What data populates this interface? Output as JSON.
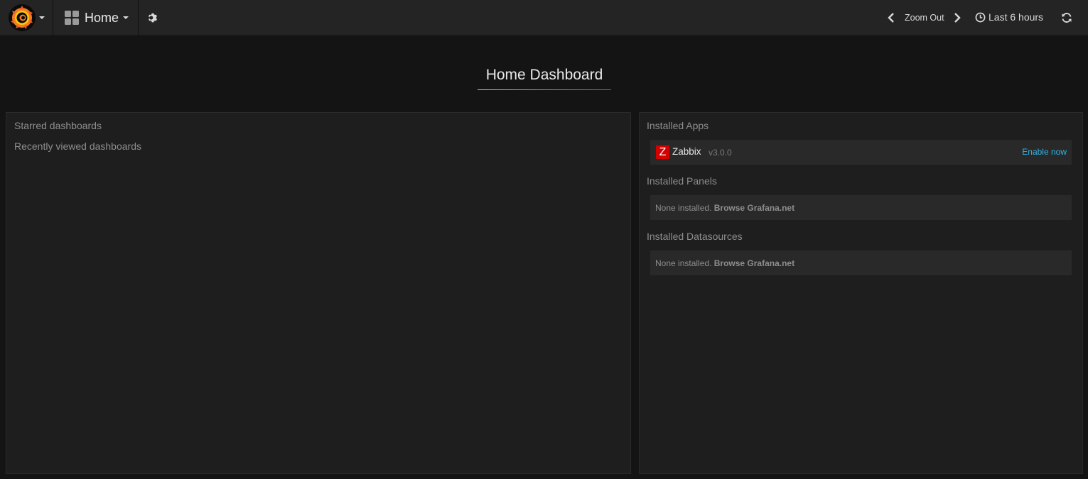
{
  "topbar": {
    "home_label": "Home",
    "zoom_out_label": "Zoom Out",
    "time_range_label": "Last 6 hours"
  },
  "dashboard": {
    "title": "Home Dashboard"
  },
  "left_panel": {
    "starred_heading": "Starred dashboards",
    "recent_heading": "Recently viewed dashboards"
  },
  "right_panel": {
    "apps_heading": "Installed Apps",
    "apps": [
      {
        "logo_letter": "Z",
        "name": "Zabbix",
        "version": "v3.0.0",
        "action_label": "Enable now"
      }
    ],
    "panels_heading": "Installed Panels",
    "panels_none_text": "None installed.",
    "panels_browse_link": "Browse Grafana.net",
    "datasources_heading": "Installed Datasources",
    "datasources_none_text": "None installed.",
    "datasources_browse_link": "Browse Grafana.net"
  },
  "colors": {
    "accent_link": "#33b5e5",
    "brand_orange": "#eb7b18",
    "zabbix_red": "#d40000"
  },
  "icons": [
    "grafana-logo-icon",
    "dashboard-grid-icon",
    "gear-icon",
    "chevron-left-icon",
    "chevron-right-icon",
    "clock-icon",
    "refresh-icon"
  ]
}
